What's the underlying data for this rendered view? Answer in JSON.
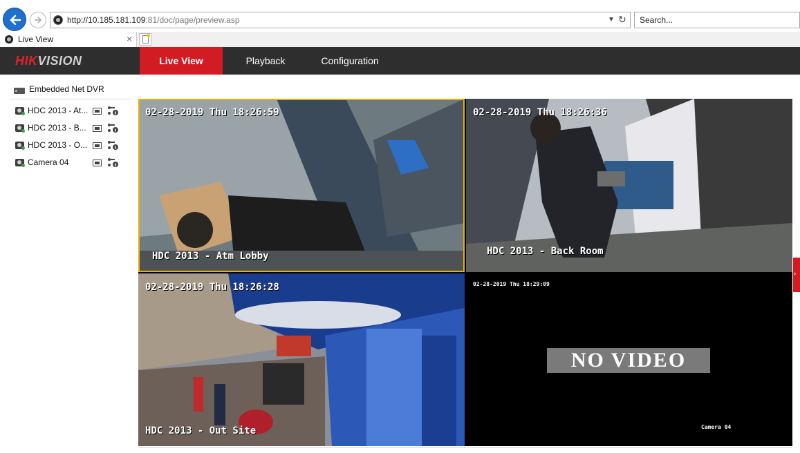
{
  "browser": {
    "url_host": "http://10.185.181.109",
    "url_rest": ":81/doc/page/preview.asp",
    "search_placeholder": "Search...",
    "tab_title": "Live View"
  },
  "app": {
    "logo_prefix": "HIK",
    "logo_suffix": "VISION",
    "nav": [
      "Live View",
      "Playback",
      "Configuration"
    ],
    "active_nav": "Live View"
  },
  "tree": {
    "device": "Embedded Net DVR",
    "cameras": [
      {
        "label": "HDC 2013 - At..."
      },
      {
        "label": "HDC 2013 - B..."
      },
      {
        "label": "HDC 2013 - O..."
      },
      {
        "label": "Camera 04"
      }
    ]
  },
  "views": [
    {
      "timestamp": "02-28-2019 Thu 18:26:59",
      "name": "HDC 2013 - Atm Lobby"
    },
    {
      "timestamp": "02-28-2019 Thu 18:26:36",
      "name": "HDC 2013 - Back Room"
    },
    {
      "timestamp": "02-28-2019 Thu 18:26:28",
      "name": "HDC 2013 - Out Site"
    },
    {
      "timestamp": "02-28-2019 Thu 18:29:09",
      "name": "Camera 04",
      "no_video": "NO VIDEO"
    }
  ],
  "colors": {
    "accent": "#d21c24",
    "header": "#2e2e2e",
    "selected_border": "#e8b400"
  }
}
